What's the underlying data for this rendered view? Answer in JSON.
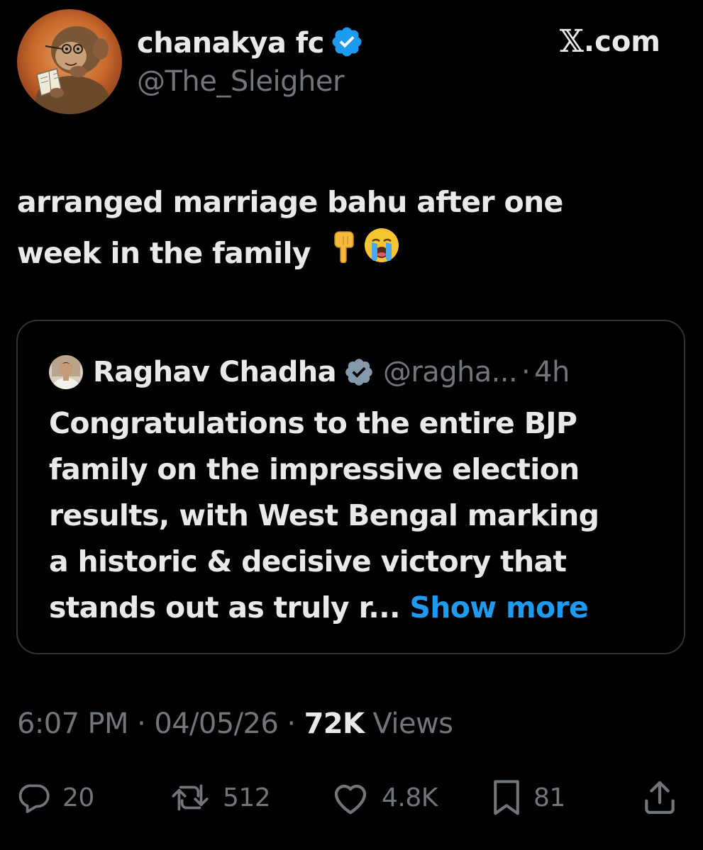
{
  "author": {
    "display_name": "chanakya fc",
    "handle": "@The_Sleigher",
    "avatar_icon": "monkey-reading-book-avatar",
    "verified": true
  },
  "site": {
    "x_letter": "𝕏",
    "suffix": ".com"
  },
  "tweet": {
    "line1": "arranged marriage bahu after one",
    "line2": "week in the family",
    "emojis": [
      "backhand-index-pointing-down-icon",
      "loudly-crying-face-icon"
    ]
  },
  "quote": {
    "name": "Raghav Chadha",
    "handle": "@ragha...",
    "dot": "·",
    "time": "4h",
    "lines": [
      "Congratulations to the entire BJP",
      "family on the impressive election",
      "results, with West Bengal marking",
      "a historic & decisive victory that"
    ],
    "last_line": "stands out as truly r...",
    "show_more": "Show more"
  },
  "meta": {
    "time": "6:07 PM",
    "sep1": " · ",
    "date": "04/05/26",
    "sep2": " · ",
    "views_count": "72K",
    "views_label": " Views"
  },
  "actions": {
    "replies": "20",
    "reposts": "512",
    "likes": "4.8K",
    "bookmarks": "81"
  },
  "colors": {
    "background": "#000000",
    "text": "#e7e9ea",
    "muted": "#71767b",
    "link": "#1d9bf0",
    "verified": "#1d9bf0",
    "border": "#2f3336"
  }
}
